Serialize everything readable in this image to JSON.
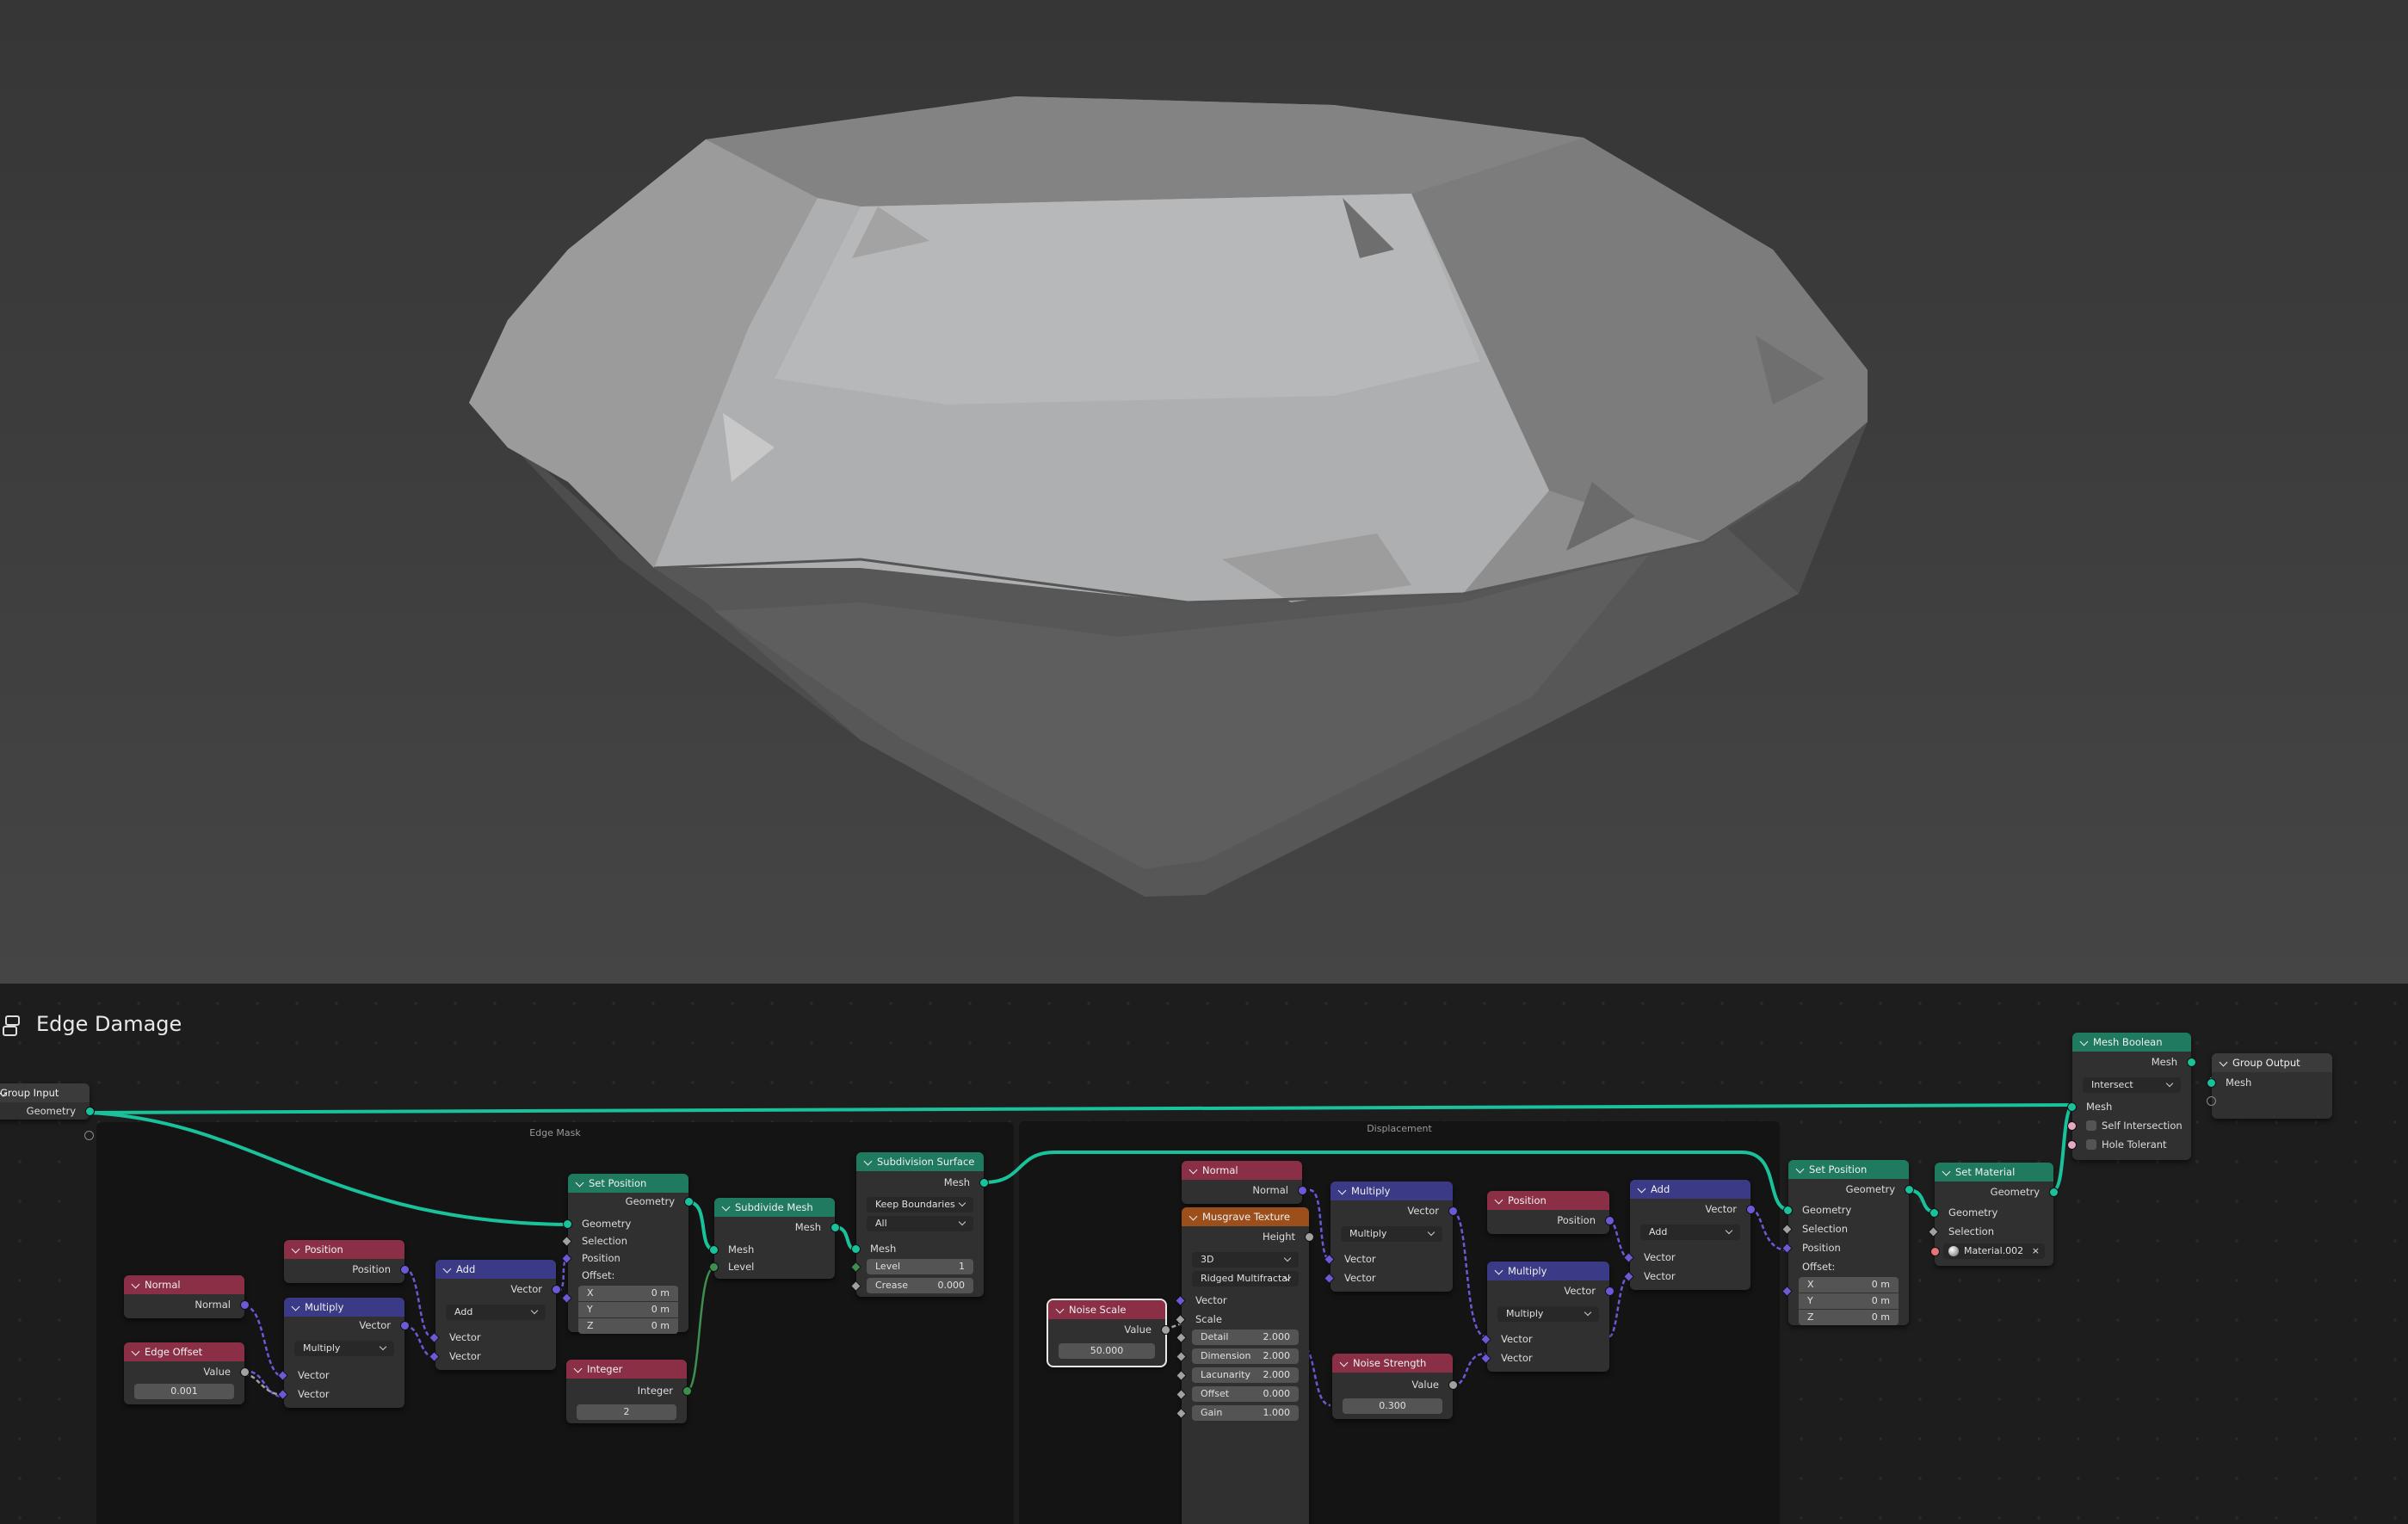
{
  "editor": {
    "title": "Edge Damage"
  },
  "frames": {
    "edge_mask": "Edge Mask",
    "displacement": "Displacement"
  },
  "colors": {
    "geometry_header": "#1f7a60",
    "input_header": "#8a2f45",
    "vector_header": "#3a3a86",
    "texture_header": "#9c4f1b",
    "geometry_wire": "#19c29a",
    "vector_wire": "#6a5ad8"
  },
  "nodes": {
    "group_input": {
      "title": "Group Input",
      "geometry": "Geometry"
    },
    "normal_1": {
      "title": "Normal",
      "normal": "Normal"
    },
    "edge_offset": {
      "title": "Edge Offset",
      "value_label": "Value",
      "value": "0.001"
    },
    "position_1": {
      "title": "Position",
      "position": "Position"
    },
    "multiply_1": {
      "title": "Multiply",
      "out": "Vector",
      "op": "Multiply",
      "in1": "Vector",
      "in2": "Vector"
    },
    "add_1": {
      "title": "Add",
      "out": "Vector",
      "op": "Add",
      "in1": "Vector",
      "in2": "Vector"
    },
    "set_position_1": {
      "title": "Set Position",
      "out": "Geometry",
      "geometry": "Geometry",
      "selection": "Selection",
      "position": "Position",
      "offset": "Offset:",
      "x": "X",
      "y": "Y",
      "z": "Z",
      "xv": "0 m",
      "yv": "0 m",
      "zv": "0 m"
    },
    "integer": {
      "title": "Integer",
      "out": "Integer",
      "value": "2"
    },
    "subdivide_mesh": {
      "title": "Subdivide Mesh",
      "out": "Mesh",
      "mesh": "Mesh",
      "level": "Level"
    },
    "subdivision_surface": {
      "title": "Subdivision Surface",
      "out": "Mesh",
      "boundaries": "Keep Boundaries",
      "uv": "All",
      "mesh": "Mesh",
      "level_label": "Level",
      "level": "1",
      "crease_label": "Crease",
      "crease": "0.000"
    },
    "noise_scale": {
      "title": "Noise Scale",
      "value_label": "Value",
      "value": "50.000"
    },
    "normal_2": {
      "title": "Normal",
      "normal": "Normal"
    },
    "musgrave": {
      "title": "Musgrave Texture",
      "out": "Height",
      "dim": "3D",
      "type": "Ridged Multifractal",
      "vector": "Vector",
      "scale": "Scale",
      "detail_l": "Detail",
      "detail": "2.000",
      "dimension_l": "Dimension",
      "dimension": "2.000",
      "lacunarity_l": "Lacunarity",
      "lacunarity": "2.000",
      "offset_l": "Offset",
      "offset": "0.000",
      "gain_l": "Gain",
      "gain": "1.000"
    },
    "multiply_2": {
      "title": "Multiply",
      "out": "Vector",
      "op": "Multiply",
      "in1": "Vector",
      "in2": "Vector"
    },
    "noise_strength": {
      "title": "Noise Strength",
      "value_label": "Value",
      "value": "0.300"
    },
    "position_2": {
      "title": "Position",
      "position": "Position"
    },
    "multiply_3": {
      "title": "Multiply",
      "out": "Vector",
      "op": "Multiply",
      "in1": "Vector",
      "in2": "Vector"
    },
    "add_2": {
      "title": "Add",
      "out": "Vector",
      "op": "Add",
      "in1": "Vector",
      "in2": "Vector"
    },
    "set_position_2": {
      "title": "Set Position",
      "out": "Geometry",
      "geometry": "Geometry",
      "selection": "Selection",
      "position": "Position",
      "offset": "Offset:",
      "x": "X",
      "y": "Y",
      "z": "Z",
      "xv": "0 m",
      "yv": "0 m",
      "zv": "0 m"
    },
    "set_material": {
      "title": "Set Material",
      "out": "Geometry",
      "geometry": "Geometry",
      "selection": "Selection",
      "material": "Material.002"
    },
    "mesh_boolean": {
      "title": "Mesh Boolean",
      "out": "Mesh",
      "op": "Intersect",
      "mesh": "Mesh",
      "self": "Self Intersection",
      "hole": "Hole Tolerant"
    },
    "group_output": {
      "title": "Group Output",
      "mesh": "Mesh"
    }
  }
}
